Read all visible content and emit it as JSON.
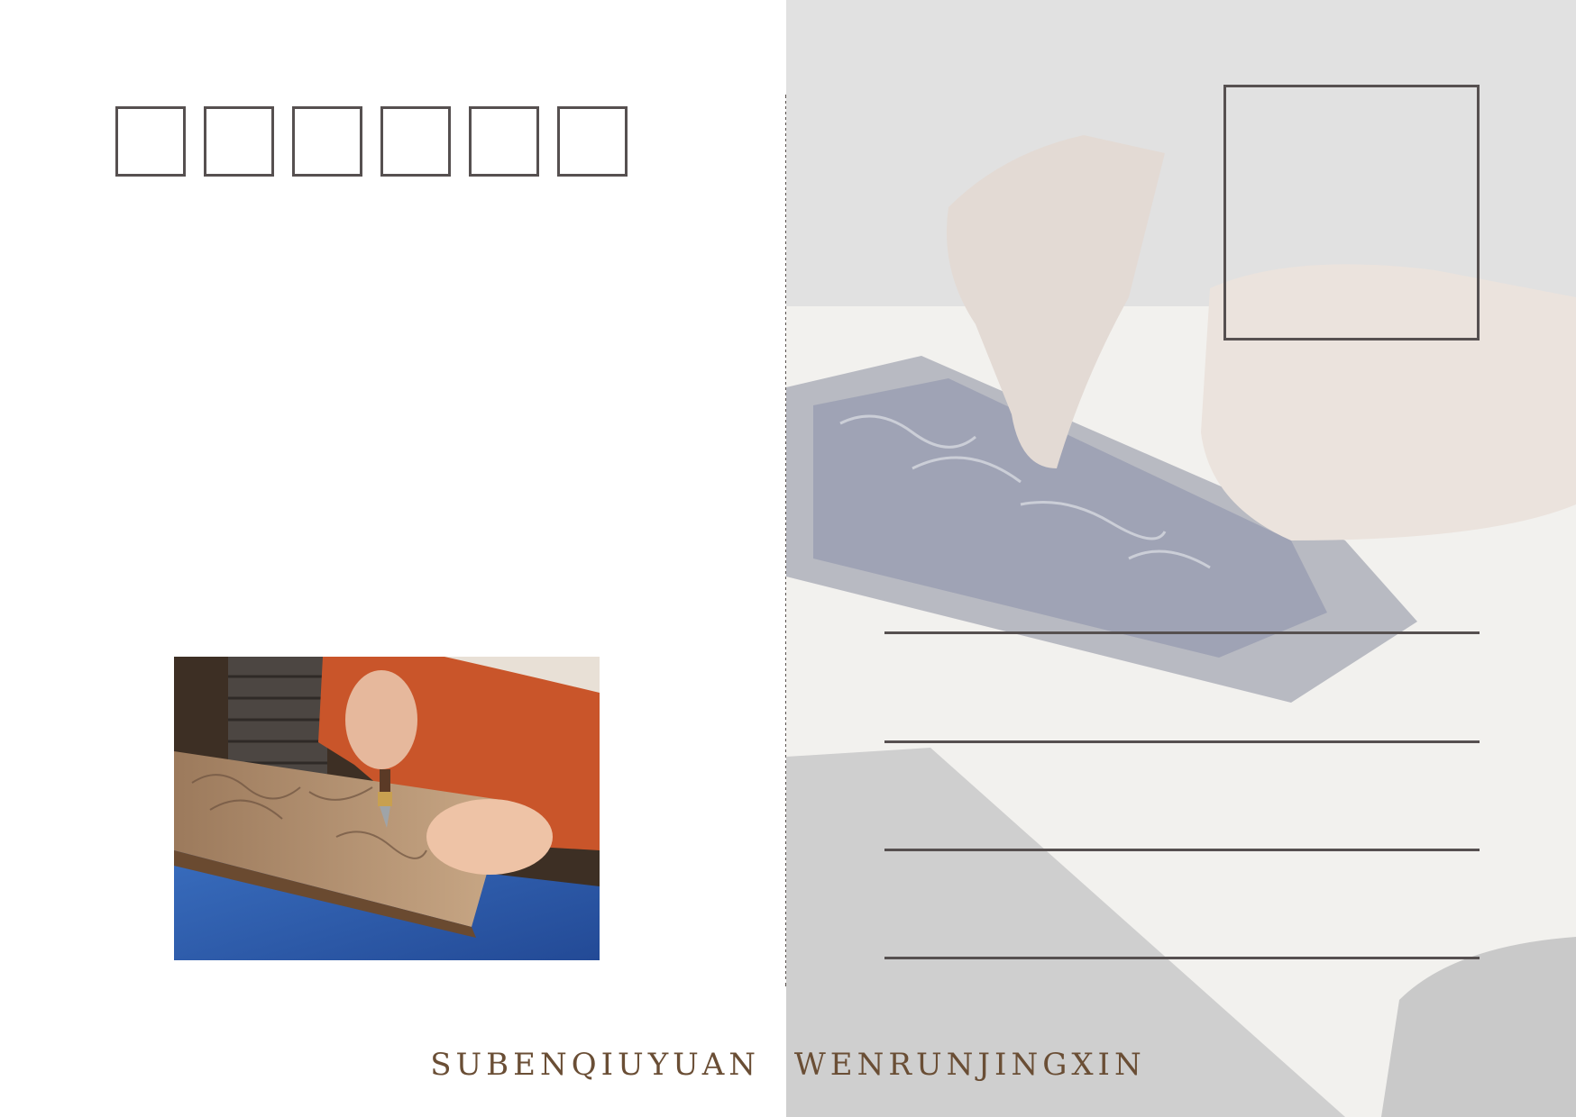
{
  "postcode": {
    "box_count": 6
  },
  "footer": {
    "text": "SUBENQIUYUAN WENRUNJINGXIN"
  },
  "colors": {
    "frame": "#565050",
    "footer_text": "#6a4e35"
  },
  "images": {
    "left_photo": "woodblock carving photo",
    "right_background": "faded woodblock printing photo"
  }
}
